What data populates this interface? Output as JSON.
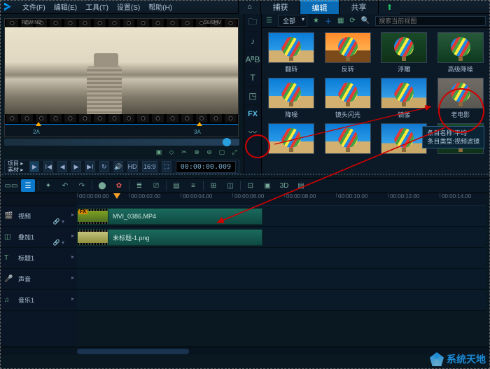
{
  "menu": {
    "file": "文件(F)",
    "edit": "编辑(E)",
    "tools": "工具(T)",
    "settings": "设置(S)",
    "help": "帮助(H)"
  },
  "modes": {
    "capture": "捕获",
    "edit": "编辑",
    "share": "共享"
  },
  "preview": {
    "rewind_label": "REWIND",
    "format_label": "S8/8MV",
    "marker_a": "2A",
    "marker_b": "3A",
    "project_label": "项目 ▸",
    "source_label": "素材 ▸",
    "hd_label": "HD",
    "aspect_label": "16:9",
    "timecode": "00:00:00.009"
  },
  "fx_panel": {
    "category": "全部",
    "search_placeholder": "搜索当前视图",
    "effects": [
      {
        "label": "翻转",
        "skin": "blue"
      },
      {
        "label": "反转",
        "skin": "orange"
      },
      {
        "label": "浮雕",
        "skin": "green"
      },
      {
        "label": "高级降噪",
        "skin": "green2"
      },
      {
        "label": "降噪",
        "skin": "blue"
      },
      {
        "label": "镜头闪光",
        "skin": "blue"
      },
      {
        "label": "镜像",
        "skin": "blue2"
      },
      {
        "label": "老电影",
        "skin": "old"
      },
      {
        "label": "",
        "skin": "blue"
      },
      {
        "label": "",
        "skin": "blue"
      },
      {
        "label": "",
        "skin": "blue2"
      },
      {
        "label": "",
        "skin": "green"
      }
    ],
    "tooltip_line1": "条目名称:平均",
    "tooltip_line2": "条目类型:视频滤镜"
  },
  "ruler": {
    "ticks": [
      "00:00:00.00",
      "00:00:02.00",
      "00:00:04.00",
      "00:00:06.00",
      "00:00:08.00",
      "00:00:10.00",
      "00:00:12.00",
      "00:00:14.00"
    ]
  },
  "tracks": {
    "video": "视频",
    "overlay": "叠加1",
    "title": "标题1",
    "voice": "声音",
    "music": "音乐1",
    "link_icon": "🔗 ▾"
  },
  "clips": {
    "video_name": "MVI_0386.MP4",
    "overlay_name": "未标题-1.png",
    "fx_badge": "FX"
  },
  "tl_toolbar": {
    "threeD": "3D"
  },
  "watermark": "系统天地"
}
